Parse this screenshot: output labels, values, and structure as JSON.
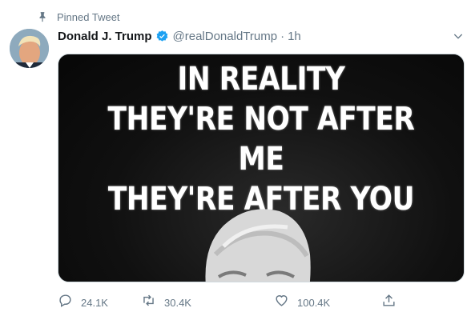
{
  "pinned": {
    "label": "Pinned Tweet",
    "icon": "pin-icon"
  },
  "author": {
    "name": "Donald J. Trump",
    "handle": "@realDonaldTrump",
    "separator": "·",
    "time": "1h",
    "verified": true,
    "avatar": "avatar-photo"
  },
  "media": {
    "lines": [
      "IN REALITY",
      "THEY'RE NOT AFTER ME",
      "THEY'RE AFTER YOU"
    ]
  },
  "actions": {
    "reply_count": "24.1K",
    "retweet_count": "30.4K",
    "like_count": "100.4K",
    "share_icon": "share-icon"
  },
  "colors": {
    "accent": "#1da1f2",
    "muted": "#657786",
    "text": "#14171a"
  }
}
